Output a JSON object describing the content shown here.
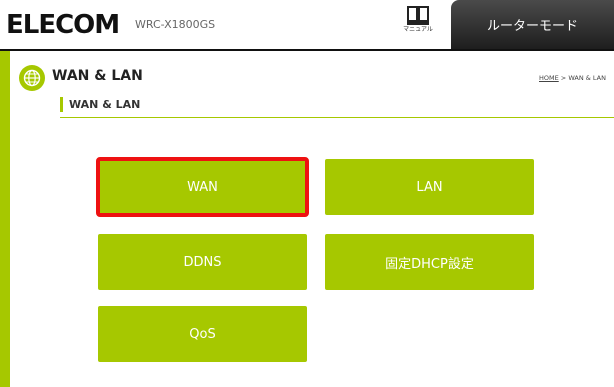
{
  "header": {
    "logo": "ELECOM",
    "model": "WRC-X1800GS",
    "manual_label": "マニュアル",
    "mode_label": "ルーターモード"
  },
  "page": {
    "title": "WAN & LAN",
    "breadcrumb_home": "HOME",
    "breadcrumb_sep": " > ",
    "breadcrumb_current": "WAN & LAN",
    "section_title": "WAN & LAN"
  },
  "menu": {
    "wan": "WAN",
    "lan": "LAN",
    "ddns": "DDNS",
    "dhcp": "固定DHCP設定",
    "qos": "QoS",
    "selected": "WAN"
  },
  "colors": {
    "accent": "#a6c800",
    "highlight": "#ee1111"
  }
}
